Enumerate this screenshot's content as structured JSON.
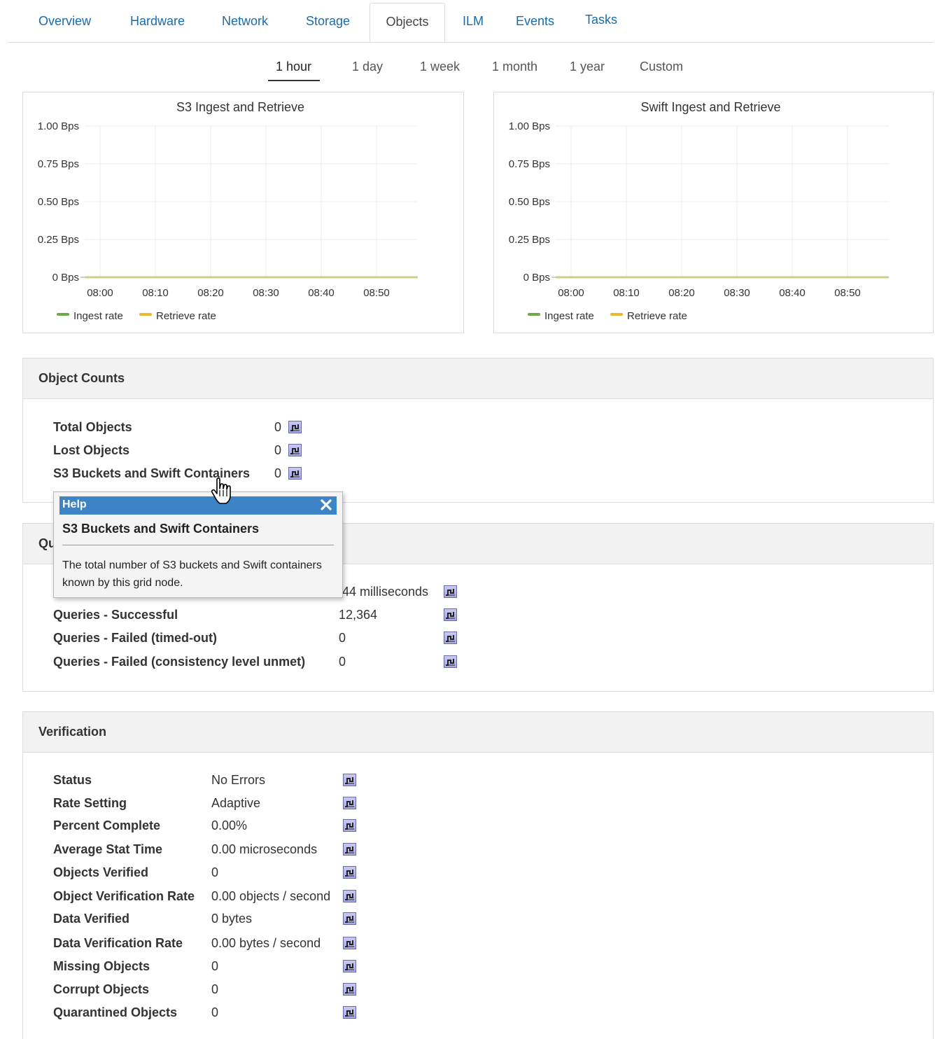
{
  "tabs": [
    {
      "label": "Overview"
    },
    {
      "label": "Hardware"
    },
    {
      "label": "Network"
    },
    {
      "label": "Storage"
    },
    {
      "label": "Objects",
      "active": true
    },
    {
      "label": "ILM"
    },
    {
      "label": "Events"
    },
    {
      "label": "Tasks"
    }
  ],
  "time_ranges": [
    {
      "label": "1 hour",
      "active": true
    },
    {
      "label": "1 day"
    },
    {
      "label": "1 week"
    },
    {
      "label": "1 month"
    },
    {
      "label": "1 year"
    },
    {
      "label": "Custom"
    }
  ],
  "colors": {
    "link": "#1a6bab",
    "ingest": "#6dab4a",
    "retrieve": "#e8b92e",
    "flat_line": "#d2cc8a",
    "help_bar": "#3d84c6",
    "icon_fill": "#b6b6e6"
  },
  "chart_data": [
    {
      "type": "line",
      "title": "S3 Ingest and Retrieve",
      "x": [
        "08:00",
        "08:10",
        "08:20",
        "08:30",
        "08:40",
        "08:50"
      ],
      "y_ticks": [
        "1.00 Bps",
        "0.75 Bps",
        "0.50 Bps",
        "0.25 Bps",
        "0 Bps"
      ],
      "ylim": [
        0,
        1
      ],
      "series": [
        {
          "name": "Ingest rate",
          "values": [
            0,
            0,
            0,
            0,
            0,
            0
          ]
        },
        {
          "name": "Retrieve rate",
          "values": [
            0,
            0,
            0,
            0,
            0,
            0
          ]
        }
      ],
      "grid": true,
      "legend": "bottom-left"
    },
    {
      "type": "line",
      "title": "Swift Ingest and Retrieve",
      "x": [
        "08:00",
        "08:10",
        "08:20",
        "08:30",
        "08:40",
        "08:50"
      ],
      "y_ticks": [
        "1.00 Bps",
        "0.75 Bps",
        "0.50 Bps",
        "0.25 Bps",
        "0 Bps"
      ],
      "ylim": [
        0,
        1
      ],
      "series": [
        {
          "name": "Ingest rate",
          "values": [
            0,
            0,
            0,
            0,
            0,
            0
          ]
        },
        {
          "name": "Retrieve rate",
          "values": [
            0,
            0,
            0,
            0,
            0,
            0
          ]
        }
      ],
      "grid": true,
      "legend": "bottom-left"
    }
  ],
  "object_counts": {
    "title": "Object Counts",
    "rows": [
      {
        "label": "Total Objects",
        "value": "0"
      },
      {
        "label": "Lost Objects",
        "value": "0"
      },
      {
        "label": "S3 Buckets and Swift Containers",
        "value": "0"
      }
    ]
  },
  "queries": {
    "title_visible": "Qu",
    "rows": [
      {
        "label": "",
        "value": ".44 milliseconds"
      },
      {
        "label": "Queries - Successful",
        "value": "12,364"
      },
      {
        "label": "Queries - Failed (timed-out)",
        "value": "0"
      },
      {
        "label": "Queries - Failed (consistency level unmet)",
        "value": "0"
      }
    ]
  },
  "verification": {
    "title": "Verification",
    "rows": [
      {
        "label": "Status",
        "value": "No Errors"
      },
      {
        "label": "Rate Setting",
        "value": "Adaptive"
      },
      {
        "label": "Percent Complete",
        "value": "0.00%"
      },
      {
        "label": "Average Stat Time",
        "value": "0.00 microseconds"
      },
      {
        "label": "Objects Verified",
        "value": "0"
      },
      {
        "label": "Object Verification Rate",
        "value": "0.00 objects / second"
      },
      {
        "label": "Data Verified",
        "value": "0 bytes"
      },
      {
        "label": "Data Verification Rate",
        "value": "0.00 bytes / second"
      },
      {
        "label": "Missing Objects",
        "value": "0"
      },
      {
        "label": "Corrupt Objects",
        "value": "0"
      },
      {
        "label": "Quarantined Objects",
        "value": "0"
      }
    ]
  },
  "help": {
    "bar_title": "Help",
    "title": "S3 Buckets and Swift Containers",
    "text": "The total number of S3 buckets and Swift containers known by this grid node."
  }
}
